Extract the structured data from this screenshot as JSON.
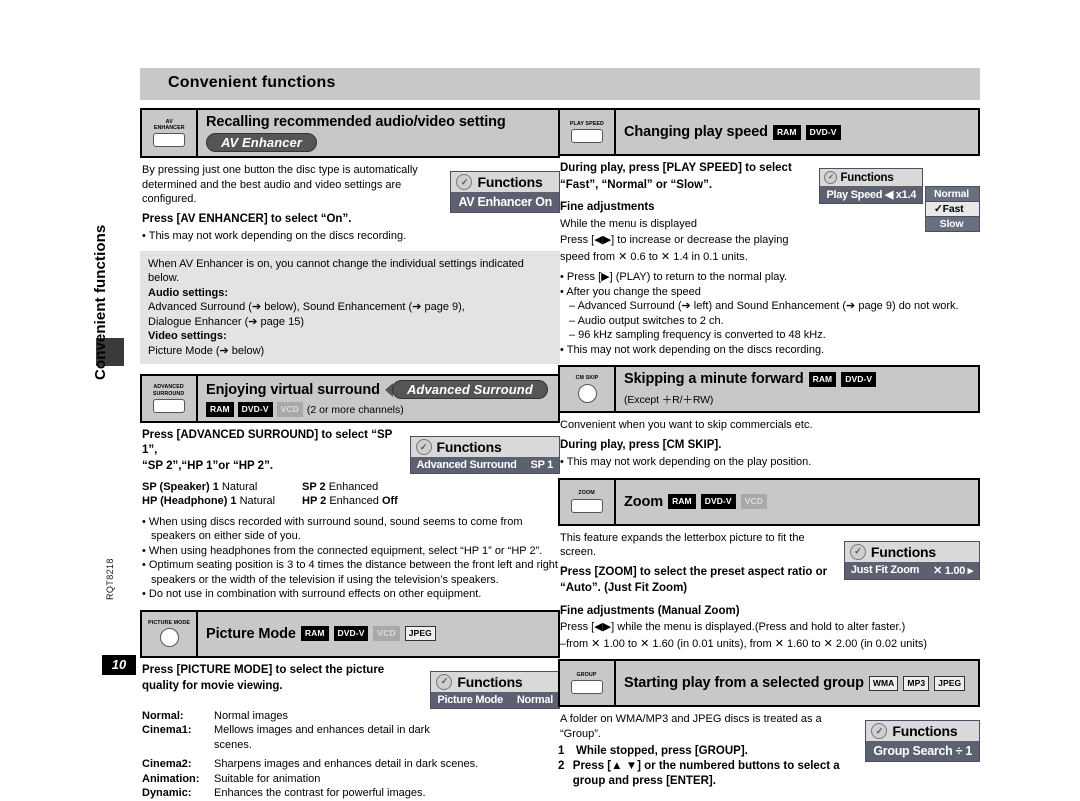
{
  "page": {
    "chapter_tab_label": "Convenient functions",
    "doc_code": "RQT8218",
    "page_number": "10",
    "banner_title": "Convenient functions"
  },
  "functions_label": "Functions",
  "left_column": {
    "av_enhancer": {
      "button_label": "AV\nENHANCER",
      "title": "Recalling recommended audio/video setting",
      "pill": "AV Enhancer",
      "intro": "By pressing just one button the disc type is automatically determined and the best audio and video settings are configured.",
      "instruction": "Press [AV ENHANCER] to select “On”.",
      "bullet": "This may not work depending on the discs recording.",
      "osd": {
        "header": "Functions",
        "row_label": "AV Enhancer On"
      },
      "grey_note": {
        "lead": "When AV Enhancer is on, you cannot change the individual settings indicated below.",
        "audio_heading": "Audio settings:",
        "audio_line1": "Advanced Surround (➔ below), Sound Enhancement (➔ page 9),",
        "audio_line2": "Dialogue Enhancer (➔ page 15)",
        "video_heading": "Video settings:",
        "video_line": "Picture Mode (➔ below)"
      }
    },
    "advanced_surround": {
      "button_label": "ADVANCED\nSURROUND",
      "title": "Enjoying virtual surround",
      "pill": "Advanced Surround",
      "badges": [
        {
          "text": "RAM",
          "state": "on"
        },
        {
          "text": "DVD-V",
          "state": "on"
        },
        {
          "text": "VCD",
          "state": "off"
        }
      ],
      "badge_note": "(2 or more channels)",
      "instruction_line1": "Press [ADVANCED SURROUND] to select “SP 1”,",
      "instruction_line2": "“SP 2”,“HP 1”or “HP 2”.",
      "modes": [
        {
          "k": "SP (Speaker) 1",
          "v": "Natural",
          "k2": "SP 2",
          "v2": "Enhanced",
          "v3": ""
        },
        {
          "k": "HP (Headphone) 1",
          "v": "Natural",
          "k2": "HP 2",
          "v2": "Enhanced",
          "v3": "Off"
        }
      ],
      "osd": {
        "header": "Functions",
        "row_label": "Advanced Surround",
        "row_value": "SP 1"
      },
      "bullets": [
        "When using discs recorded with surround sound, sound seems to come from speakers on either side of you.",
        "When using headphones from the connected equipment, select “HP 1” or “HP 2”.",
        "Optimum seating position is 3 to 4 times the distance between the front left and right speakers or the width of the television if using the television’s speakers.",
        "Do not use in combination with surround effects on other equipment."
      ]
    },
    "picture_mode": {
      "button_label": "PICTURE MODE",
      "title": "Picture Mode",
      "badges": [
        {
          "text": "RAM",
          "state": "on"
        },
        {
          "text": "DVD-V",
          "state": "on"
        },
        {
          "text": "VCD",
          "state": "off"
        },
        {
          "text": "JPEG",
          "state": "outline"
        }
      ],
      "instruction_line1": "Press [PICTURE MODE] to select the picture",
      "instruction_line2": "quality for movie viewing.",
      "osd": {
        "header": "Functions",
        "row_label": "Picture Mode",
        "row_value": "Normal"
      },
      "modes": [
        {
          "k": "Normal:",
          "v": "Normal images"
        },
        {
          "k": "Cinema1:",
          "v": "Mellows images and enhances detail in dark scenes."
        },
        {
          "k": "Cinema2:",
          "v": "Sharpens images and enhances detail in dark scenes."
        },
        {
          "k": "Animation:",
          "v": "Suitable for animation"
        },
        {
          "k": "Dynamic:",
          "v": "Enhances the contrast for powerful images."
        }
      ]
    }
  },
  "right_column": {
    "play_speed": {
      "button_label": "PLAY SPEED",
      "title": "Changing play speed",
      "badges": [
        {
          "text": "RAM",
          "state": "on"
        },
        {
          "text": "DVD-V",
          "state": "on"
        }
      ],
      "instruction_line1": "During play, press [PLAY SPEED] to select",
      "instruction_line2": "“Fast”, “Normal” or “Slow”.",
      "fine_heading": "Fine adjustments",
      "fine_line1": "While the menu is displayed",
      "fine_line2": "Press [◀▶] to increase or decrease the playing",
      "fine_line3": "speed from ✕ 0.6 to ✕ 1.4 in 0.1 units.",
      "osd": {
        "header": "Functions",
        "row_label": "Play Speed ◀ x1.4"
      },
      "dropdown": [
        {
          "label": "Normal",
          "selected": false
        },
        {
          "label": "✓Fast",
          "selected": true
        },
        {
          "label": "Slow",
          "selected": false
        }
      ],
      "bullets": [
        "Press [▶] (PLAY) to return to the normal play.",
        "After you change the speed"
      ],
      "sub_bullets": [
        "– Advanced Surround (➔ left) and Sound Enhancement (➔ page 9) do not work.",
        "– Audio output switches to 2 ch.",
        "– 96 kHz sampling frequency is converted to 48 kHz."
      ],
      "last_bullet": "This may not work depending on the discs recording."
    },
    "cm_skip": {
      "button_label": "CM SKIP",
      "title": "Skipping a minute forward",
      "badges": [
        {
          "text": "RAM",
          "state": "on"
        },
        {
          "text": "DVD-V",
          "state": "on"
        }
      ],
      "badge_note": "(Except ＋R/＋RW)",
      "intro": "Convenient when you want to skip commercials etc.",
      "instruction": "During play, press [CM SKIP].",
      "bullet": "This may not work depending on the play position."
    },
    "zoom": {
      "button_label": "ZOOM",
      "title": "Zoom",
      "badges": [
        {
          "text": "RAM",
          "state": "on"
        },
        {
          "text": "DVD-V",
          "state": "on"
        },
        {
          "text": "VCD",
          "state": "off"
        }
      ],
      "intro": "This feature expands the letterbox picture to fit the screen.",
      "instruction_line1": "Press [ZOOM] to select the preset aspect ratio or",
      "instruction_line2": "“Auto”. (Just Fit Zoom)",
      "osd": {
        "header": "Functions",
        "row_label": "Just Fit Zoom",
        "row_value": "✕ 1.00 ▸"
      },
      "fine_heading": "Fine adjustments (Manual Zoom)",
      "fine_line1": "Press [◀▶] while the menu is displayed.(Press and hold to alter faster.)",
      "fine_line2": "–from ✕ 1.00 to ✕ 1.60 (in 0.01 units), from ✕ 1.60 to ✕ 2.00 (in 0.02 units)"
    },
    "group": {
      "button_label": "GROUP",
      "title": "Starting play from a selected group",
      "badges": [
        {
          "text": "WMA",
          "state": "outline"
        },
        {
          "text": "MP3",
          "state": "outline"
        },
        {
          "text": "JPEG",
          "state": "outline"
        }
      ],
      "intro": "A folder on WMA/MP3 and JPEG discs is treated as a “Group”.",
      "steps": [
        {
          "n": "1",
          "text": "While stopped, press [GROUP]."
        },
        {
          "n": "2",
          "text": "Press [▲ ▼] or the numbered buttons to select a group and press [ENTER]."
        }
      ],
      "osd": {
        "header": "Functions",
        "row_label": "Group Search ÷ 1"
      }
    }
  }
}
